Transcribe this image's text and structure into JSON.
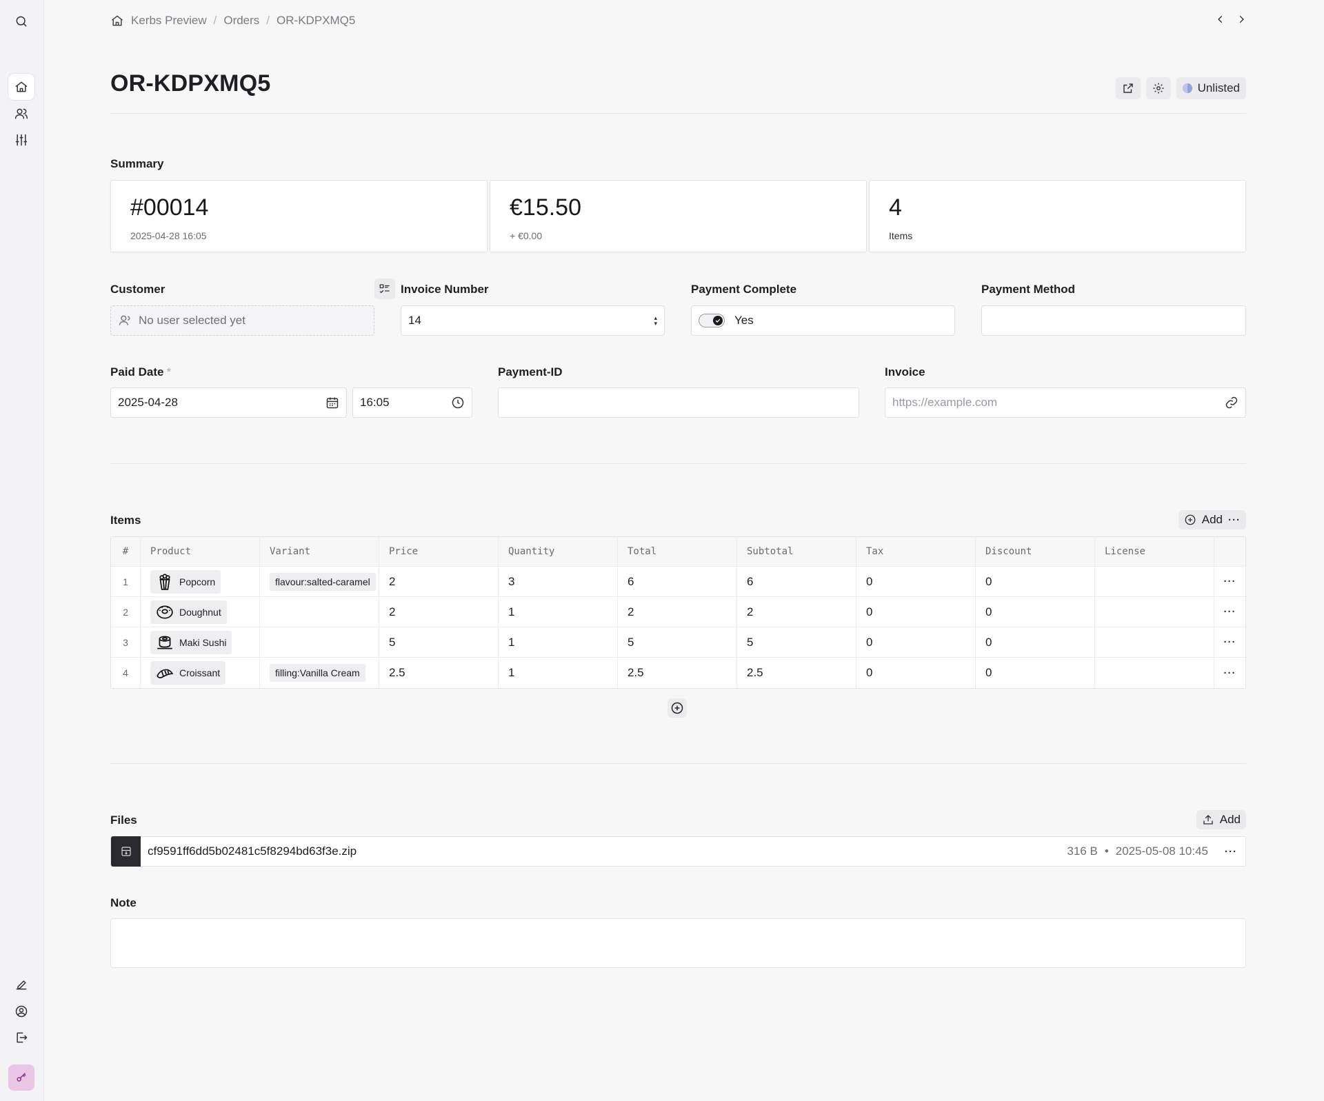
{
  "breadcrumb": {
    "items": [
      "Kerbs Preview",
      "Orders",
      "OR-KDPXMQ5"
    ],
    "separator": "/"
  },
  "page": {
    "title": "OR-KDPXMQ5",
    "visibility_label": "Unlisted"
  },
  "summary": {
    "label": "Summary",
    "cards": [
      {
        "big": "#00014",
        "small": "2025-04-28 16:05"
      },
      {
        "big": "€15.50",
        "small": "+ €0.00"
      },
      {
        "big": "4",
        "small": "Items"
      }
    ]
  },
  "form": {
    "customer": {
      "label": "Customer",
      "placeholder": "No user selected yet"
    },
    "invoice_number": {
      "label": "Invoice Number",
      "value": "14"
    },
    "payment_complete": {
      "label": "Payment Complete",
      "value": "Yes",
      "checked": true
    },
    "payment_method": {
      "label": "Payment Method",
      "value": ""
    },
    "paid_date": {
      "label": "Paid Date",
      "required_mark": "*",
      "date": "2025-04-28",
      "time": "16:05"
    },
    "payment_id": {
      "label": "Payment-ID",
      "value": ""
    },
    "invoice": {
      "label": "Invoice",
      "placeholder": "https://example.com"
    }
  },
  "items": {
    "label": "Items",
    "add_label": "Add",
    "more_label": "···",
    "columns": [
      "#",
      "Product",
      "Variant",
      "Price",
      "Quantity",
      "Total",
      "Subtotal",
      "Tax",
      "Discount",
      "License"
    ],
    "rows": [
      {
        "n": "1",
        "product": "Popcorn",
        "icon": "popcorn-icon",
        "variant": "flavour:salted-caramel",
        "price": "2",
        "quantity": "3",
        "total": "6",
        "subtotal": "6",
        "tax": "0",
        "discount": "0",
        "license": ""
      },
      {
        "n": "2",
        "product": "Doughnut",
        "icon": "doughnut-icon",
        "variant": "",
        "price": "2",
        "quantity": "1",
        "total": "2",
        "subtotal": "2",
        "tax": "0",
        "discount": "0",
        "license": ""
      },
      {
        "n": "3",
        "product": "Maki Sushi",
        "icon": "sushi-icon",
        "variant": "",
        "price": "5",
        "quantity": "1",
        "total": "5",
        "subtotal": "5",
        "tax": "0",
        "discount": "0",
        "license": ""
      },
      {
        "n": "4",
        "product": "Croissant",
        "icon": "croissant-icon",
        "variant": "filling:Vanilla Cream",
        "price": "2.5",
        "quantity": "1",
        "total": "2.5",
        "subtotal": "2.5",
        "tax": "0",
        "discount": "0",
        "license": ""
      }
    ],
    "row_more_label": "···"
  },
  "files": {
    "label": "Files",
    "add_label": "Add",
    "list": [
      {
        "name": "cf9591ff6dd5b02481c5f8294bd63f3e.zip",
        "size": "316 B",
        "dot": "•",
        "date": "2025-05-08 10:45",
        "more": "···"
      }
    ]
  },
  "note": {
    "label": "Note",
    "value": ""
  },
  "colors": {
    "background": "#f7f7f8",
    "rail_key_accent": "#e9c6e6",
    "dark_file_icon": "#2a2a2e"
  }
}
